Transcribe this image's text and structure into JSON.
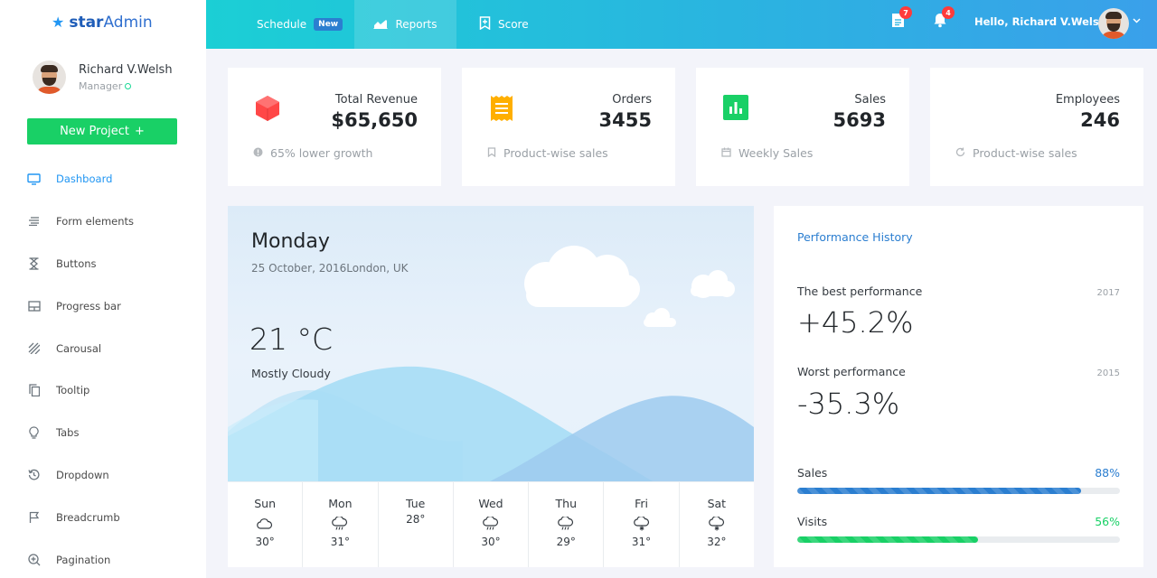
{
  "brand": {
    "prefix": "star",
    "suffix": "Admin"
  },
  "user": {
    "name": "Richard V.Welsh",
    "role": "Manager"
  },
  "sidebar": {
    "new_project_label": "New Project",
    "items": [
      {
        "label": "Dashboard",
        "icon": "monitor-icon",
        "active": true
      },
      {
        "label": "Form elements",
        "icon": "lines-icon"
      },
      {
        "label": "Buttons",
        "icon": "hourglass-icon"
      },
      {
        "label": "Progress bar",
        "icon": "layout-icon"
      },
      {
        "label": "Carousal",
        "icon": "stripes-icon"
      },
      {
        "label": "Tooltip",
        "icon": "copy-icon"
      },
      {
        "label": "Tabs",
        "icon": "bulb-icon"
      },
      {
        "label": "Dropdown",
        "icon": "history-icon"
      },
      {
        "label": "Breadcrumb",
        "icon": "flag-icon"
      },
      {
        "label": "Pagination",
        "icon": "zoom-plus-icon"
      }
    ]
  },
  "topbar": {
    "tabs": [
      {
        "label": "Schedule",
        "badge": "New"
      },
      {
        "label": "Reports"
      },
      {
        "label": "Score"
      }
    ],
    "messages_count": "7",
    "notifications_count": "4",
    "greeting": "Hello, Richard V.Welsh !"
  },
  "stats": [
    {
      "label": "Total Revenue",
      "value": "$65,650",
      "foot": "65% lower growth",
      "icon": "cube-icon",
      "color": "#ff4747"
    },
    {
      "label": "Orders",
      "value": "3455",
      "foot": "Product-wise sales",
      "icon": "receipt-icon",
      "color": "#ffaf00"
    },
    {
      "label": "Sales",
      "value": "5693",
      "foot": "Weekly Sales",
      "icon": "poll-icon",
      "color": "#19d066"
    },
    {
      "label": "Employees",
      "value": "246",
      "foot": "Product-wise sales",
      "icon": "users-icon",
      "color": "#2196f3"
    }
  ],
  "weather": {
    "day": "Monday",
    "date": "25 October, 2016London, UK",
    "temp": "21 °C",
    "condition": "Mostly Cloudy",
    "forecast": [
      {
        "day": "Sun",
        "temp": "30°",
        "icon": "cloud-icon"
      },
      {
        "day": "Mon",
        "temp": "31°",
        "icon": "rain-cloud-icon"
      },
      {
        "day": "Tue",
        "temp": "28°",
        "icon": ""
      },
      {
        "day": "Wed",
        "temp": "30°",
        "icon": "rain-cloud-icon"
      },
      {
        "day": "Thu",
        "temp": "29°",
        "icon": "rain-cloud-icon"
      },
      {
        "day": "Fri",
        "temp": "31°",
        "icon": "snow-cloud-icon"
      },
      {
        "day": "Sat",
        "temp": "32°",
        "icon": "snow-cloud-icon"
      }
    ]
  },
  "performance": {
    "title": "Performance History",
    "best_label": "The best performance",
    "best_year": "2017",
    "best_value": "+45.2%",
    "worst_label": "Worst performance",
    "worst_year": "2015",
    "worst_value": "-35.3%",
    "bars": [
      {
        "label": "Sales",
        "pct": "88%",
        "fraction": 0.88,
        "color": "#2b7ed0"
      },
      {
        "label": "Visits",
        "pct": "56%",
        "fraction": 0.56,
        "color": "#19d066"
      }
    ]
  }
}
